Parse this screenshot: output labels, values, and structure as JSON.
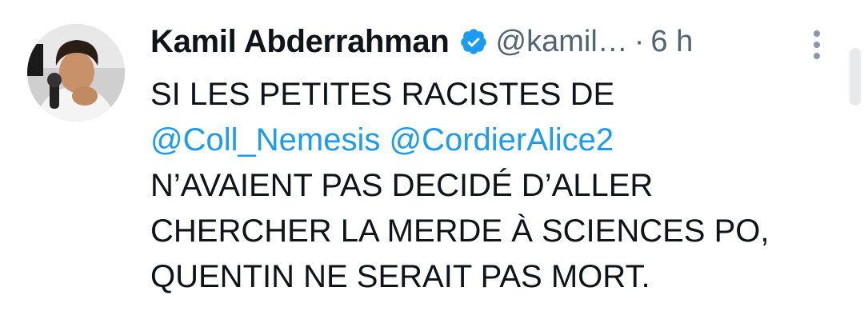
{
  "author": {
    "name": "Kamil Abderrahman",
    "handle": "@kamil…",
    "separator": "·",
    "time": "6 h",
    "verified": true
  },
  "tweet": {
    "line1": "SI LES PETITES RACISTES DE",
    "mention1": "@Coll_Nemesis",
    "mention2": "@CordierAlice2",
    "line3": "N’AVAIENT PAS DECIDÉ D’ALLER",
    "line4": "CHERCHER LA MERDE À SCIENCES PO,",
    "line5": "QUENTIN NE SERAIT PAS MORT."
  },
  "icons": {
    "verified": "verified-badge-icon",
    "more": "more-options-icon"
  },
  "colors": {
    "text": "#0f1419",
    "secondary": "#536471",
    "link": "#1d9bf0",
    "verified": "#1d9bf0"
  }
}
